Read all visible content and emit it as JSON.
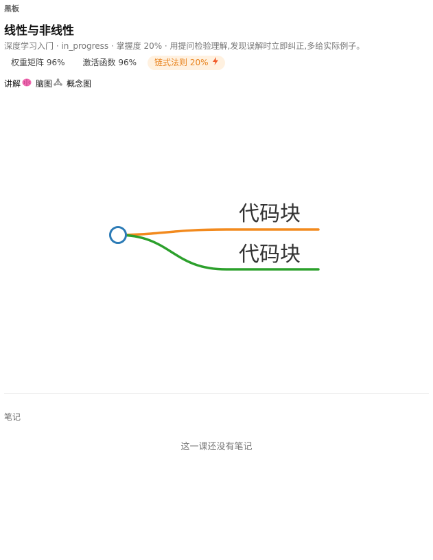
{
  "panel": {
    "label": "黑板"
  },
  "lesson": {
    "title": "线性与非线性",
    "meta": "深度学习入门 · in_progress · 掌握度 20% · 用提问检验理解,发现误解时立即纠正,多给实际例子。"
  },
  "chips": [
    {
      "label": "权重矩阵 96%",
      "active": false
    },
    {
      "label": "激活函数 96%",
      "active": false
    },
    {
      "label": "链式法则 20%",
      "active": true,
      "icon": "lightning-icon",
      "color": "#f15b2a"
    }
  ],
  "views": [
    {
      "label": "讲解",
      "icon": "brain-icon"
    },
    {
      "label": "脑图",
      "icon": "graph-icon"
    },
    {
      "label": "概念图",
      "icon": null
    }
  ],
  "mindmap": {
    "root_color": "#2c7bb6",
    "branches": [
      {
        "label": "代码块",
        "color": "#f28a1e"
      },
      {
        "label": "代码块",
        "color": "#2ca02c"
      }
    ]
  },
  "notes": {
    "label": "笔记",
    "empty": "这一课还没有笔记"
  }
}
